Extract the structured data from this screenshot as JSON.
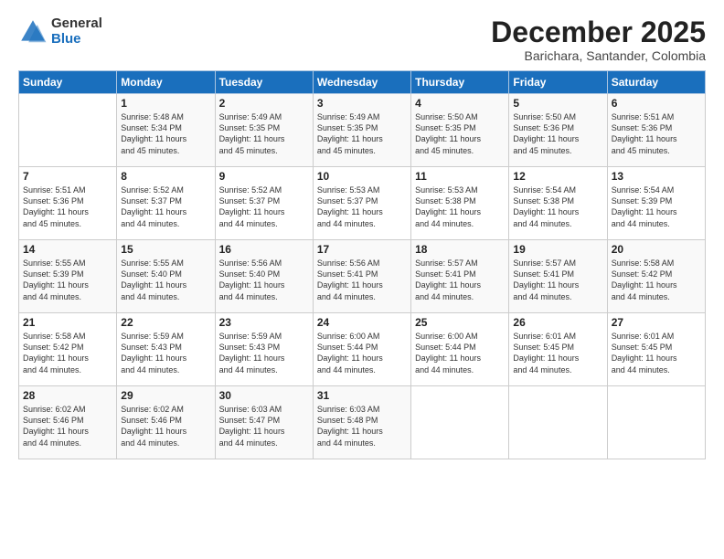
{
  "logo": {
    "general": "General",
    "blue": "Blue"
  },
  "title": "December 2025",
  "subtitle": "Barichara, Santander, Colombia",
  "days_of_week": [
    "Sunday",
    "Monday",
    "Tuesday",
    "Wednesday",
    "Thursday",
    "Friday",
    "Saturday"
  ],
  "weeks": [
    [
      {
        "day": "",
        "content": ""
      },
      {
        "day": "1",
        "content": "Sunrise: 5:48 AM\nSunset: 5:34 PM\nDaylight: 11 hours\nand 45 minutes."
      },
      {
        "day": "2",
        "content": "Sunrise: 5:49 AM\nSunset: 5:35 PM\nDaylight: 11 hours\nand 45 minutes."
      },
      {
        "day": "3",
        "content": "Sunrise: 5:49 AM\nSunset: 5:35 PM\nDaylight: 11 hours\nand 45 minutes."
      },
      {
        "day": "4",
        "content": "Sunrise: 5:50 AM\nSunset: 5:35 PM\nDaylight: 11 hours\nand 45 minutes."
      },
      {
        "day": "5",
        "content": "Sunrise: 5:50 AM\nSunset: 5:36 PM\nDaylight: 11 hours\nand 45 minutes."
      },
      {
        "day": "6",
        "content": "Sunrise: 5:51 AM\nSunset: 5:36 PM\nDaylight: 11 hours\nand 45 minutes."
      }
    ],
    [
      {
        "day": "7",
        "content": "Sunrise: 5:51 AM\nSunset: 5:36 PM\nDaylight: 11 hours\nand 45 minutes."
      },
      {
        "day": "8",
        "content": "Sunrise: 5:52 AM\nSunset: 5:37 PM\nDaylight: 11 hours\nand 44 minutes."
      },
      {
        "day": "9",
        "content": "Sunrise: 5:52 AM\nSunset: 5:37 PM\nDaylight: 11 hours\nand 44 minutes."
      },
      {
        "day": "10",
        "content": "Sunrise: 5:53 AM\nSunset: 5:37 PM\nDaylight: 11 hours\nand 44 minutes."
      },
      {
        "day": "11",
        "content": "Sunrise: 5:53 AM\nSunset: 5:38 PM\nDaylight: 11 hours\nand 44 minutes."
      },
      {
        "day": "12",
        "content": "Sunrise: 5:54 AM\nSunset: 5:38 PM\nDaylight: 11 hours\nand 44 minutes."
      },
      {
        "day": "13",
        "content": "Sunrise: 5:54 AM\nSunset: 5:39 PM\nDaylight: 11 hours\nand 44 minutes."
      }
    ],
    [
      {
        "day": "14",
        "content": "Sunrise: 5:55 AM\nSunset: 5:39 PM\nDaylight: 11 hours\nand 44 minutes."
      },
      {
        "day": "15",
        "content": "Sunrise: 5:55 AM\nSunset: 5:40 PM\nDaylight: 11 hours\nand 44 minutes."
      },
      {
        "day": "16",
        "content": "Sunrise: 5:56 AM\nSunset: 5:40 PM\nDaylight: 11 hours\nand 44 minutes."
      },
      {
        "day": "17",
        "content": "Sunrise: 5:56 AM\nSunset: 5:41 PM\nDaylight: 11 hours\nand 44 minutes."
      },
      {
        "day": "18",
        "content": "Sunrise: 5:57 AM\nSunset: 5:41 PM\nDaylight: 11 hours\nand 44 minutes."
      },
      {
        "day": "19",
        "content": "Sunrise: 5:57 AM\nSunset: 5:41 PM\nDaylight: 11 hours\nand 44 minutes."
      },
      {
        "day": "20",
        "content": "Sunrise: 5:58 AM\nSunset: 5:42 PM\nDaylight: 11 hours\nand 44 minutes."
      }
    ],
    [
      {
        "day": "21",
        "content": "Sunrise: 5:58 AM\nSunset: 5:42 PM\nDaylight: 11 hours\nand 44 minutes."
      },
      {
        "day": "22",
        "content": "Sunrise: 5:59 AM\nSunset: 5:43 PM\nDaylight: 11 hours\nand 44 minutes."
      },
      {
        "day": "23",
        "content": "Sunrise: 5:59 AM\nSunset: 5:43 PM\nDaylight: 11 hours\nand 44 minutes."
      },
      {
        "day": "24",
        "content": "Sunrise: 6:00 AM\nSunset: 5:44 PM\nDaylight: 11 hours\nand 44 minutes."
      },
      {
        "day": "25",
        "content": "Sunrise: 6:00 AM\nSunset: 5:44 PM\nDaylight: 11 hours\nand 44 minutes."
      },
      {
        "day": "26",
        "content": "Sunrise: 6:01 AM\nSunset: 5:45 PM\nDaylight: 11 hours\nand 44 minutes."
      },
      {
        "day": "27",
        "content": "Sunrise: 6:01 AM\nSunset: 5:45 PM\nDaylight: 11 hours\nand 44 minutes."
      }
    ],
    [
      {
        "day": "28",
        "content": "Sunrise: 6:02 AM\nSunset: 5:46 PM\nDaylight: 11 hours\nand 44 minutes."
      },
      {
        "day": "29",
        "content": "Sunrise: 6:02 AM\nSunset: 5:46 PM\nDaylight: 11 hours\nand 44 minutes."
      },
      {
        "day": "30",
        "content": "Sunrise: 6:03 AM\nSunset: 5:47 PM\nDaylight: 11 hours\nand 44 minutes."
      },
      {
        "day": "31",
        "content": "Sunrise: 6:03 AM\nSunset: 5:48 PM\nDaylight: 11 hours\nand 44 minutes."
      },
      {
        "day": "",
        "content": ""
      },
      {
        "day": "",
        "content": ""
      },
      {
        "day": "",
        "content": ""
      }
    ]
  ]
}
